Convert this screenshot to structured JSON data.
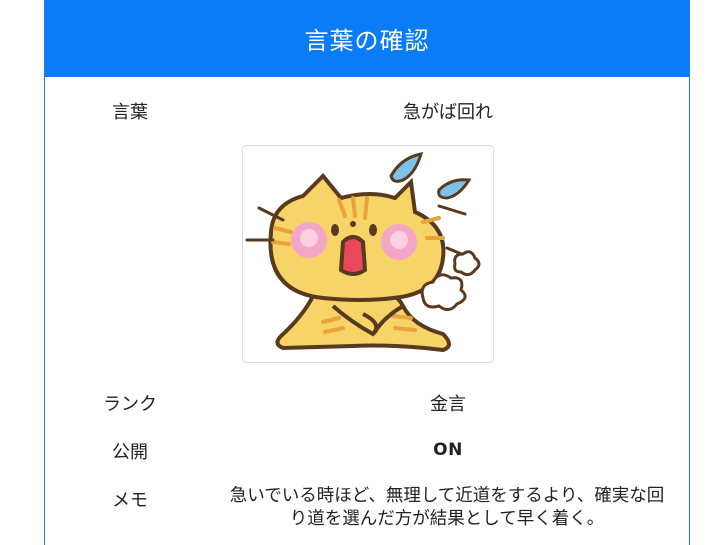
{
  "header": {
    "title": "言葉の確認"
  },
  "fields": {
    "word": {
      "label": "言葉",
      "value": "急がば回れ"
    },
    "rank": {
      "label": "ランク",
      "value": "金言"
    },
    "public": {
      "label": "公開",
      "value": "ON"
    },
    "memo": {
      "label": "メモ",
      "value": "急いでいる時ほど、無理して近道をするより、確実な回り道を選んだ方が結果として早く着く。"
    }
  },
  "image": {
    "icon": "surprised-cat-illustration"
  },
  "colors": {
    "header_bg": "#0a7cf5",
    "border": "#1d7af2"
  }
}
